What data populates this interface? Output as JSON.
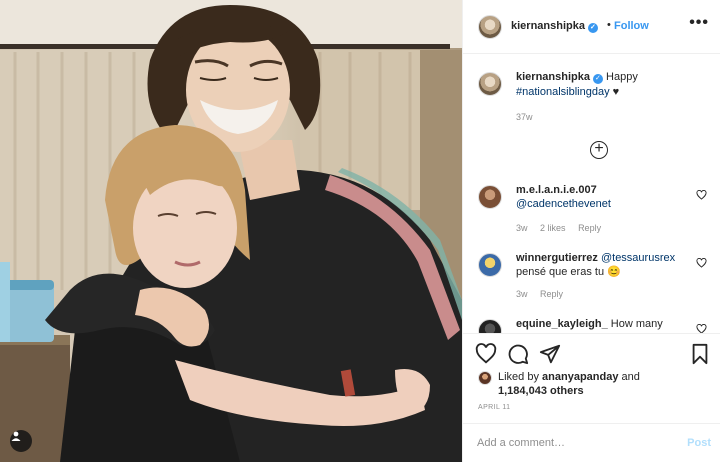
{
  "post": {
    "username": "kiernanshipka",
    "verified_mark": "✓",
    "follow_label": "Follow",
    "more_label": "•••",
    "separator": "•"
  },
  "caption": {
    "username": "kiernanshipka",
    "text": "Happy",
    "hashtag": "#nationalsiblingday",
    "emoji": "♥",
    "age": "37w"
  },
  "comments": [
    {
      "username": "m.e.l.a.n.i.e.007",
      "mention": "@cadencethevenet",
      "text": "",
      "age": "3w",
      "likes": "2 likes",
      "reply": "Reply"
    },
    {
      "username": "winnergutierrez",
      "mention": "@tessaurusrex",
      "text": "pensé que eras tu 😊",
      "age": "3w",
      "likes": "",
      "reply": "Reply"
    },
    {
      "username": "equine_kayleigh_",
      "mention": "",
      "text": "How many",
      "age": "",
      "likes": "",
      "reply": ""
    }
  ],
  "icons": [
    "tag-user-icon",
    "verified-icon",
    "more-options-icon",
    "load-more-icon",
    "heart-icon",
    "comment-icon",
    "share-icon",
    "bookmark-icon"
  ],
  "likes": {
    "liked_by_label": "Liked by",
    "liked_by_user": "ananyapanday",
    "and_label": "and",
    "others": "1,184,043 others"
  },
  "date": "APRIL 11",
  "add_comment": {
    "placeholder": "Add a comment…",
    "post_label": "Post"
  },
  "colors": {
    "link_blue": "#3897f0",
    "mention_blue": "#003569",
    "muted": "#8e8e8e",
    "post_disabled": "#b2dffc"
  }
}
